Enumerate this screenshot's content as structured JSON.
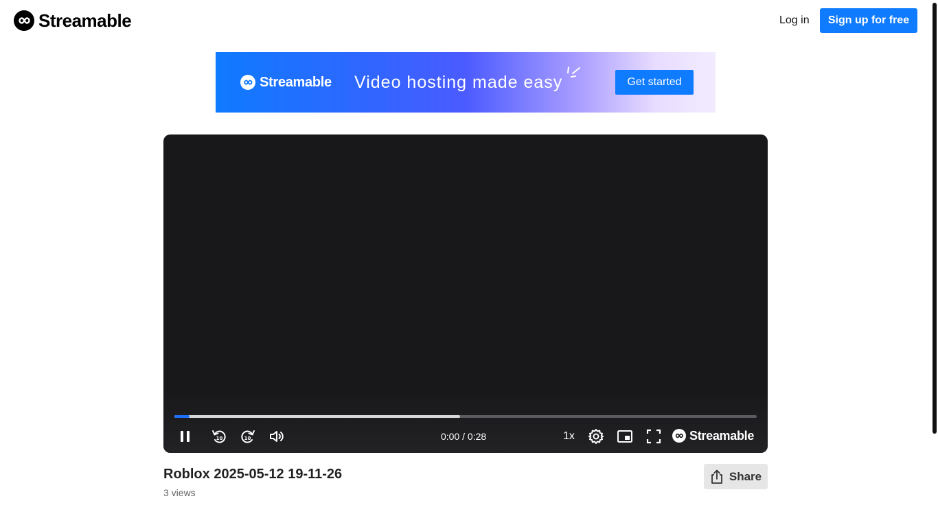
{
  "header": {
    "logo_text": "Streamable",
    "login_label": "Log in",
    "signup_label": "Sign up for free"
  },
  "banner": {
    "logo_text": "Streamable",
    "tagline": "Video hosting made easy",
    "cta_label": "Get started"
  },
  "player": {
    "time_display": "0:00 / 0:28",
    "speed_label": "1x",
    "brand_text": "Streamable",
    "progress_played_fraction": 0.026,
    "progress_buffered_fraction": 0.49,
    "icons": [
      "pause-icon",
      "rewind-10-icon",
      "forward-10-icon",
      "volume-icon",
      "gear-icon",
      "picture-in-picture-icon",
      "fullscreen-icon"
    ]
  },
  "video": {
    "title": "Roblox 2025-05-12 19-11-26",
    "views": "3 views"
  },
  "share": {
    "label": "Share"
  },
  "colors": {
    "brand_blue": "#0f7bff",
    "progress_played": "#1e6ff5",
    "player_bg": "#18181b"
  }
}
